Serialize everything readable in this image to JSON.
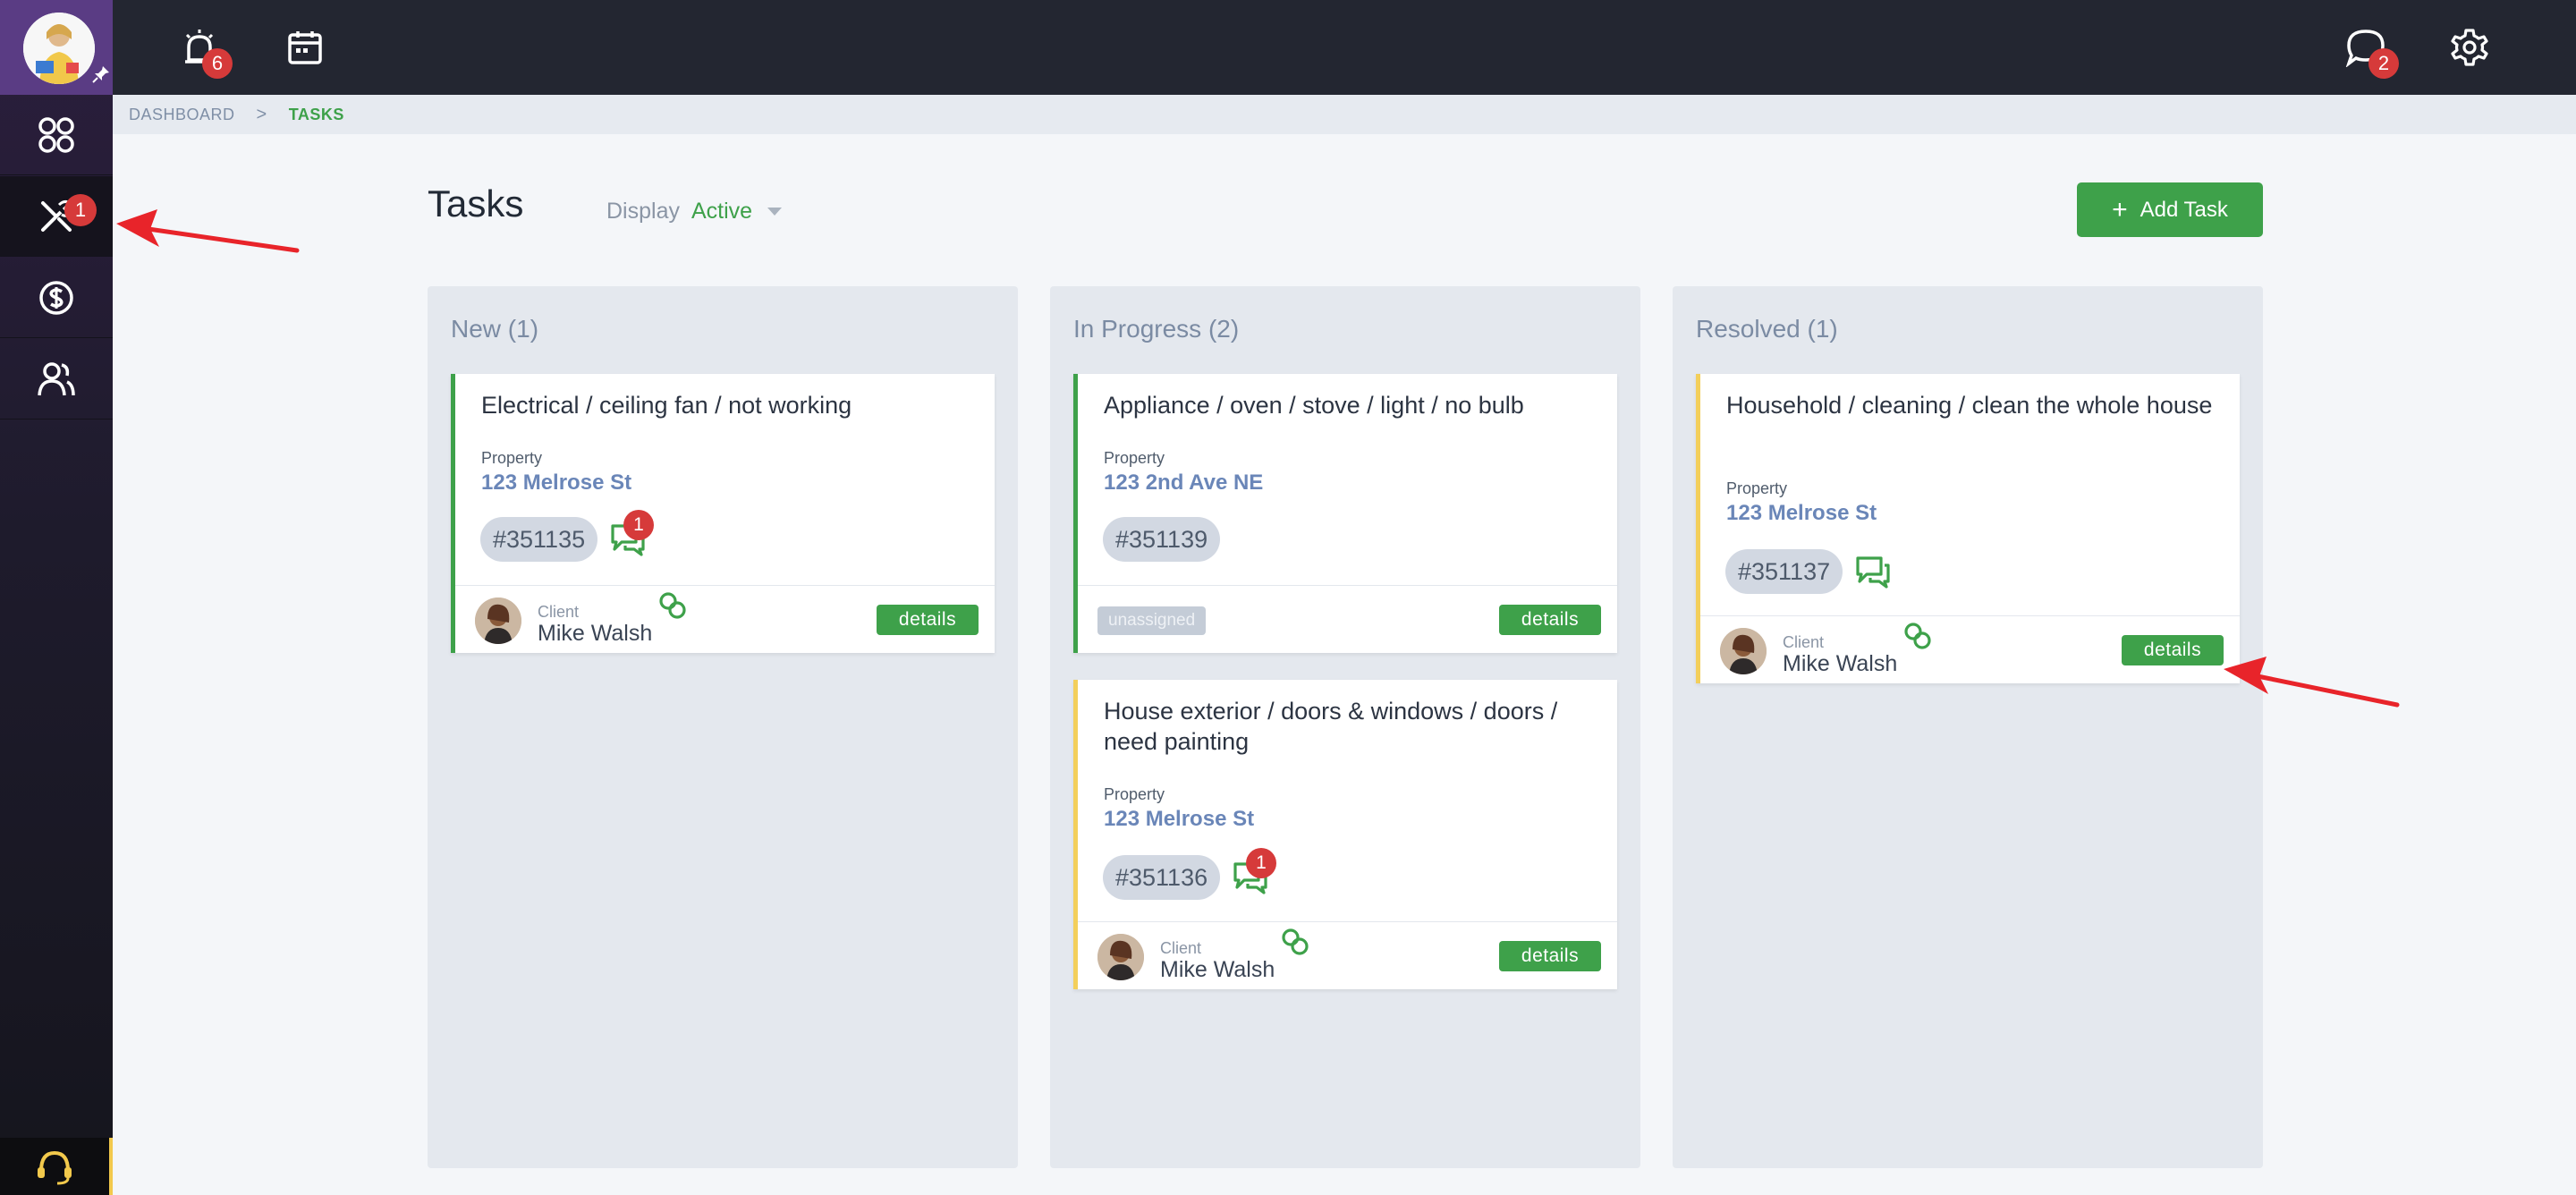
{
  "topbar": {
    "alarm_badge": "6",
    "messages_badge": "2"
  },
  "sidebar": {
    "tasks_badge": "1"
  },
  "breadcrumb": {
    "items": [
      "DASHBOARD",
      "TASKS"
    ],
    "separator": ">"
  },
  "header": {
    "title": "Tasks",
    "display_label": "Display",
    "display_value": "Active",
    "add_button": "Add Task",
    "add_icon": "+"
  },
  "columns": [
    {
      "title": "New (1)",
      "cards": [
        {
          "title": "Electrical / ceiling fan / not working",
          "property_label": "Property",
          "property": "123 Melrose St",
          "id": "#351135",
          "chat_badge": "1",
          "client_label": "Client",
          "client_name": "Mike Walsh",
          "details": "details"
        }
      ]
    },
    {
      "title": "In Progress (2)",
      "cards": [
        {
          "title": "Appliance / oven / stove / light / no bulb",
          "property_label": "Property",
          "property": "123 2nd Ave NE",
          "id": "#351139",
          "assignee": "unassigned",
          "details": "details"
        },
        {
          "title": "House exterior / doors & windows / doors / need painting",
          "property_label": "Property",
          "property": "123 Melrose St",
          "id": "#351136",
          "chat_badge": "1",
          "client_label": "Client",
          "client_name": "Mike Walsh",
          "details": "details"
        }
      ]
    },
    {
      "title": "Resolved (1)",
      "cards": [
        {
          "title": "Household / cleaning / clean the whole house",
          "property_label": "Property",
          "property": "123 Melrose St",
          "id": "#351137",
          "client_label": "Client",
          "client_name": "Mike Walsh",
          "details": "details"
        }
      ]
    }
  ],
  "colors": {
    "accent_green": "#3ea14a",
    "badge_red": "#d63a3a",
    "topbar": "#232631",
    "link_blue": "#6a86b8",
    "card_border_new": "#3ea14a",
    "card_border_pending": "#f3cf5b",
    "annotation_arrow": "#e8242a"
  },
  "icons": [
    "user-avatar",
    "pin-icon",
    "dashboard-grid-icon",
    "tools-icon",
    "dollar-icon",
    "users-icon",
    "headset-icon",
    "alarm-icon",
    "calendar-icon",
    "chat-icon",
    "gear-icon",
    "link-icon"
  ]
}
